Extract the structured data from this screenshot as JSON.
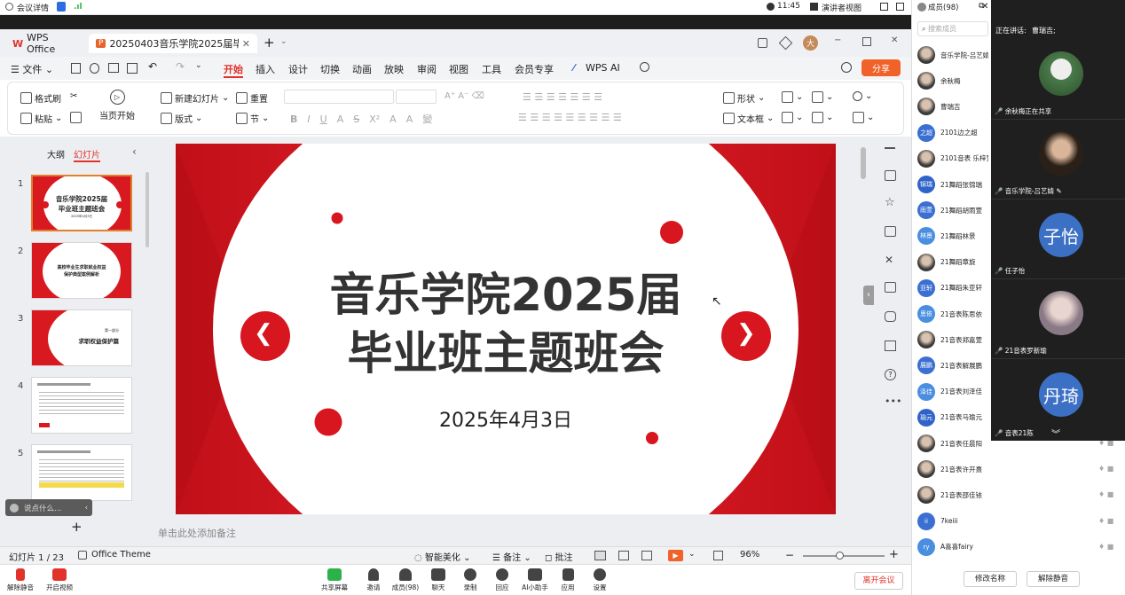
{
  "meeting": {
    "details": "会议详情",
    "time": "11:45",
    "presenter_view": "演讲者视图",
    "members_count": "成员(98)"
  },
  "wps": {
    "app_tab": "WPS Office",
    "doc_tab": "20250403音乐学院2025届毕业班",
    "avatar_initial": "大"
  },
  "menu": {
    "file": "文件",
    "items": [
      "开始",
      "插入",
      "设计",
      "切换",
      "动画",
      "放映",
      "审阅",
      "视图",
      "工具",
      "会员专享"
    ],
    "wpsai": "WPS AI",
    "share": "分享"
  },
  "ribbon": {
    "format_painter": "格式刷",
    "paste": "粘贴",
    "from_start": "当页开始",
    "new_slide": "新建幻灯片",
    "reset": "重置",
    "layout": "版式",
    "section": "节",
    "shape": "形状",
    "textbox": "文本框"
  },
  "panel": {
    "outline": "大纲",
    "slides": "幻灯片",
    "search_placeholder": "说点什么..."
  },
  "thumbs": [
    {
      "n": "1",
      "t1": "音乐学院2025届",
      "t2": "毕业班主题班会",
      "t3": "2025年4月3日"
    },
    {
      "n": "2",
      "t1": "高校毕业生求职就业权益",
      "t2": "保护典型案例解析"
    },
    {
      "n": "3",
      "t1": "第一部分",
      "t2": "求职权益保护篇"
    },
    {
      "n": "4"
    },
    {
      "n": "5"
    }
  ],
  "slide": {
    "title1": "音乐学院2025届",
    "title2": "毕业班主题班会",
    "date": "2025年4月3日"
  },
  "notes_placeholder": "单击此处添加备注",
  "status": {
    "page": "幻灯片 1 / 23",
    "theme": "Office Theme",
    "beautify": "智能美化",
    "notes": "备注",
    "comment": "批注",
    "zoom": "96%"
  },
  "bottombar": {
    "items": [
      "解除静音",
      "开启视频",
      "共享屏幕",
      "邀请",
      "成员(98)",
      "聊天",
      "录制",
      "回应",
      "AI小助手",
      "应用",
      "设置"
    ],
    "leave": "离开会议"
  },
  "members": {
    "search": "搜索成员",
    "list": [
      {
        "av": "",
        "name": "音乐学院-吕艺婧(我)"
      },
      {
        "av": "",
        "name": "余秋梅"
      },
      {
        "av": "",
        "name": "曹瑞吉"
      },
      {
        "av": "之超",
        "name": "2101边之超"
      },
      {
        "av": "",
        "name": "2101音表 乐梓萱"
      },
      {
        "av": "锦瑞",
        "name": "21舞蹈张锦瑞"
      },
      {
        "av": "雨萱",
        "name": "21舞蹈胡雨萱"
      },
      {
        "av": "林景",
        "name": "21舞蹈林景"
      },
      {
        "av": "",
        "name": "21舞蹈章旋"
      },
      {
        "av": "亚轩",
        "name": "21舞蹈朱亚轩"
      },
      {
        "av": "思依",
        "name": "21音表陈思依"
      },
      {
        "av": "",
        "name": "21音表郑嘉萱"
      },
      {
        "av": "展鹏",
        "name": "21音表解展鹏"
      },
      {
        "av": "泽佳",
        "name": "21音表刘泽佳"
      },
      {
        "av": "瑜元",
        "name": "21音表马瑜元"
      },
      {
        "av": "",
        "name": "21音表任晨阳"
      },
      {
        "av": "",
        "name": "21音表许开熹"
      },
      {
        "av": "",
        "name": "21音表邵佳铱"
      },
      {
        "av": "ii",
        "name": "7keiii"
      },
      {
        "av": "ry",
        "name": "A喜喜fairy"
      }
    ],
    "rename": "修改名称",
    "unmute": "解除静音"
  },
  "video": {
    "speaking_label": "正在讲话:",
    "speaker": "曹瑞吉;",
    "tiles": [
      {
        "label": "余秋梅正在共享",
        "avatar": ""
      },
      {
        "label": "音乐学院-吕艺婧",
        "avatar": ""
      },
      {
        "label": "任子怡",
        "avatar": "子怡"
      },
      {
        "label": "21音表罗新瑜",
        "avatar": ""
      },
      {
        "label": "音表21陈",
        "avatar": "丹琦"
      }
    ]
  }
}
